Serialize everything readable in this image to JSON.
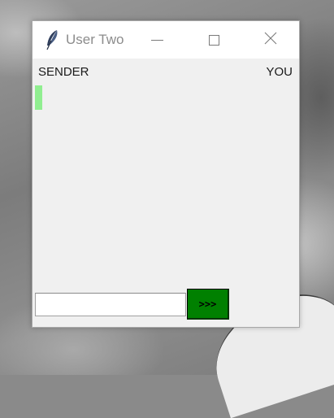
{
  "window": {
    "title": "User Two",
    "icon": "feather-icon",
    "controls": {
      "minimize": "minimize-icon",
      "maximize": "maximize-icon",
      "close": "close-icon"
    }
  },
  "chat": {
    "sender_label": "SENDER",
    "you_label": "YOU",
    "cursor_color": "#90ee90"
  },
  "composer": {
    "input_value": "",
    "send_label": ">>>",
    "send_color": "#008000"
  }
}
